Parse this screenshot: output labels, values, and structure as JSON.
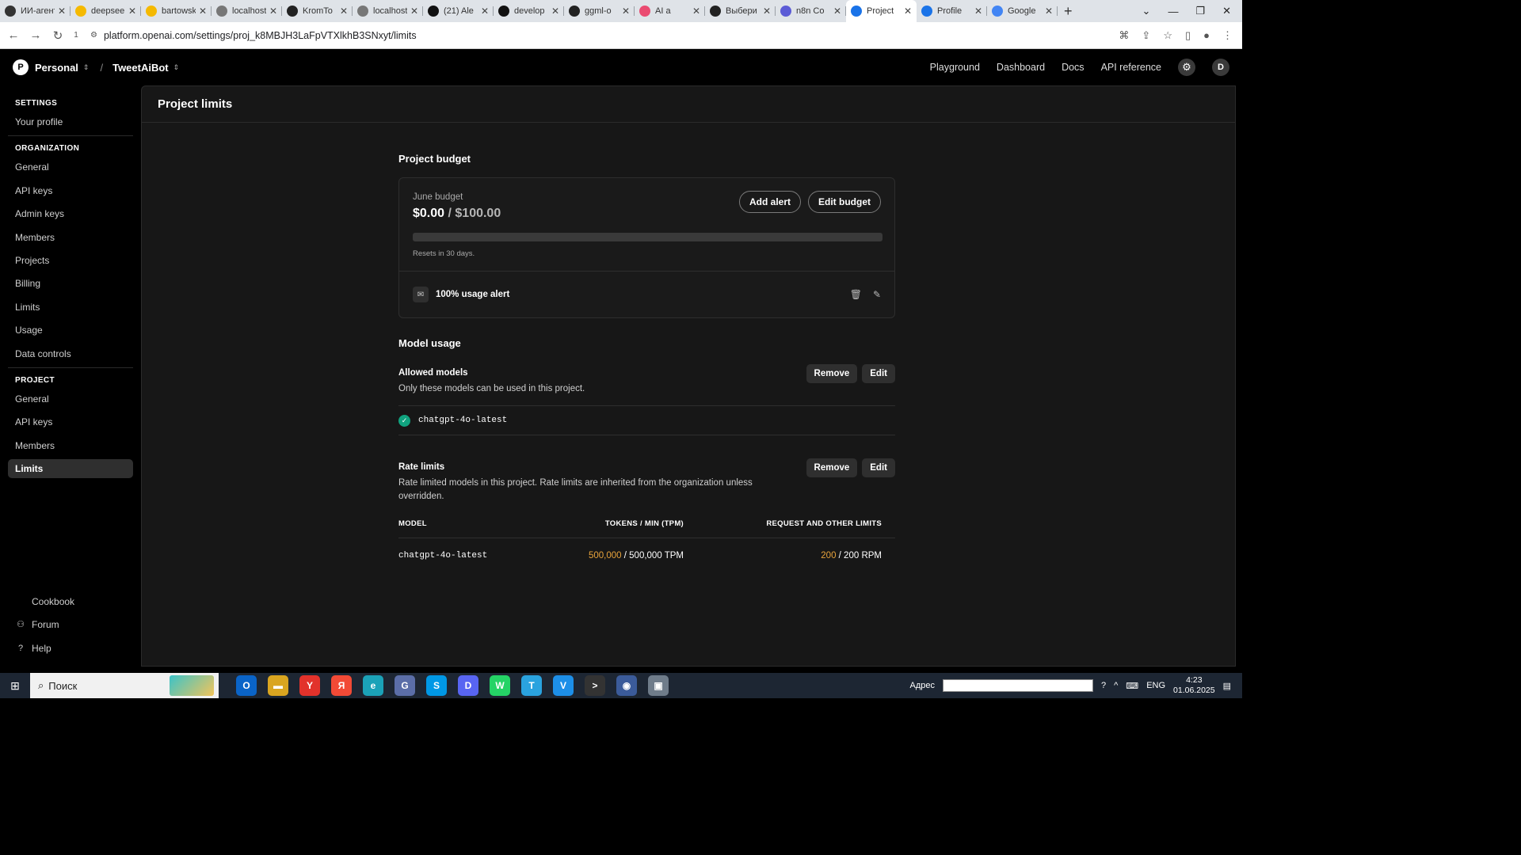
{
  "browser": {
    "tabs": [
      {
        "label": "ИИ-агент",
        "icon": "openai-icon",
        "color": "#333333"
      },
      {
        "label": "deepseek",
        "icon": "hf-icon",
        "color": "#f5b900"
      },
      {
        "label": "bartowski",
        "icon": "hf-icon",
        "color": "#f5b900"
      },
      {
        "label": "localhost",
        "icon": "globe-icon",
        "color": "#777777"
      },
      {
        "label": "KromTo",
        "icon": "github-icon",
        "color": "#222222"
      },
      {
        "label": "localhost",
        "icon": "globe-icon",
        "color": "#777777"
      },
      {
        "label": "(21) Ale",
        "icon": "x-icon",
        "color": "#111111"
      },
      {
        "label": "develop",
        "icon": "x-icon",
        "color": "#111111"
      },
      {
        "label": "ggml-o",
        "icon": "github-icon",
        "color": "#222222"
      },
      {
        "label": "AI a",
        "icon": "n8n-icon",
        "color": "#ea4b71"
      },
      {
        "label": "Выбери",
        "icon": "github-icon",
        "color": "#222222"
      },
      {
        "label": "n8n Co",
        "icon": "n8n-icon",
        "color": "#5b5bd6"
      },
      {
        "label": "Project",
        "icon": "openai-icon",
        "color": "#1a73e8",
        "active": true
      },
      {
        "label": "Profile",
        "icon": "openai-icon",
        "color": "#1a73e8"
      },
      {
        "label": "Google",
        "icon": "google-icon",
        "color": "#4285f4"
      }
    ],
    "url": "platform.openai.com/settings/proj_k8MBJH3LaFpVTXlkhB3SNxyt/limits",
    "tab_count_badge": "1"
  },
  "header": {
    "org_initial": "P",
    "org_name": "Personal",
    "project_name": "TweetAiBot",
    "nav": [
      "Playground",
      "Dashboard",
      "Docs",
      "API reference"
    ],
    "user_initial": "D"
  },
  "sidebar": {
    "settings_title": "SETTINGS",
    "settings_items": [
      "Your profile"
    ],
    "org_title": "ORGANIZATION",
    "org_items": [
      "General",
      "API keys",
      "Admin keys",
      "Members",
      "Projects",
      "Billing",
      "Limits",
      "Usage",
      "Data controls"
    ],
    "project_title": "PROJECT",
    "project_items": [
      "General",
      "API keys",
      "Members",
      "Limits"
    ],
    "active_project_item": "Limits",
    "bottom_items": [
      {
        "label": "Cookbook",
        "icon": "code-icon"
      },
      {
        "label": "Forum",
        "icon": "people-icon"
      },
      {
        "label": "Help",
        "icon": "help-icon"
      }
    ]
  },
  "page": {
    "title": "Project limits",
    "budget": {
      "section_title": "Project budget",
      "label": "June budget",
      "spent": "$0.00",
      "limit": "$100.00",
      "progress_fraction": 0.0,
      "add_alert": "Add alert",
      "edit_budget": "Edit budget",
      "resets": "Resets in 30 days.",
      "alert_label": "100% usage alert"
    },
    "model_usage": {
      "section_title": "Model usage",
      "allowed_title": "Allowed models",
      "allowed_desc": "Only these models can be used in this project.",
      "remove": "Remove",
      "edit": "Edit",
      "allowed_models": [
        "chatgpt-4o-latest"
      ],
      "rate_title": "Rate limits",
      "rate_desc": "Rate limited models in this project. Rate limits are inherited from the organization unless overridden.",
      "columns": [
        "MODEL",
        "TOKENS / MIN (TPM)",
        "REQUEST AND OTHER LIMITS"
      ],
      "rows": [
        {
          "model": "chatgpt-4o-latest",
          "tpm_used": "500,000",
          "tpm_total": "/ 500,000 TPM",
          "rpm_used": "200",
          "rpm_total": "/ 200 RPM"
        }
      ]
    }
  },
  "taskbar": {
    "search_placeholder": "Поиск",
    "address_label": "Адрес",
    "lang": "ENG",
    "time": "4:23",
    "date": "01.06.2025",
    "apps": [
      {
        "name": "outlook-app",
        "glyph": "O",
        "color": "#0a64c8"
      },
      {
        "name": "explorer-app",
        "glyph": "▬",
        "color": "#d9a520"
      },
      {
        "name": "yandex-browser-app",
        "glyph": "Y",
        "color": "#e2322b"
      },
      {
        "name": "yandex-app",
        "glyph": "Я",
        "color": "#f24a36"
      },
      {
        "name": "edge-app",
        "glyph": "e",
        "color": "#1ba2b8"
      },
      {
        "name": "gitextensions-app",
        "glyph": "G",
        "color": "#5b6ea8"
      },
      {
        "name": "skype-app",
        "glyph": "S",
        "color": "#0098e6"
      },
      {
        "name": "discord-app",
        "glyph": "D",
        "color": "#5865f2"
      },
      {
        "name": "whatsapp-app",
        "glyph": "W",
        "color": "#25d366"
      },
      {
        "name": "telegram-app",
        "glyph": "T",
        "color": "#2aa3df"
      },
      {
        "name": "vscode-app",
        "glyph": "V",
        "color": "#1d8fe8"
      },
      {
        "name": "terminal-app",
        "glyph": ">",
        "color": "#333333"
      },
      {
        "name": "chrome-app",
        "glyph": "◉",
        "color": "#3b5b9a"
      },
      {
        "name": "remote-app",
        "glyph": "▣",
        "color": "#6f7c8a"
      }
    ]
  }
}
